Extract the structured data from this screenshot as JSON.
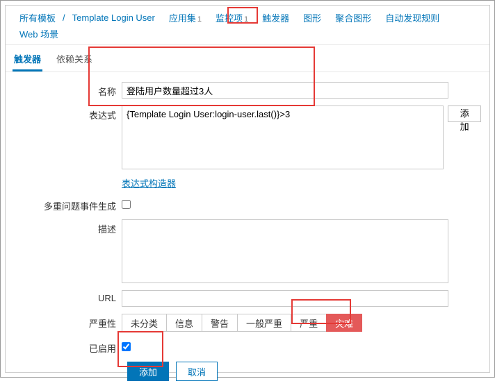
{
  "breadcrumb": {
    "root": "所有模板",
    "template": "Template Login User",
    "nav": [
      {
        "label": "应用集",
        "count": "1"
      },
      {
        "label": "监控项",
        "count": "1"
      },
      {
        "label": "触发器"
      },
      {
        "label": "图形"
      },
      {
        "label": "聚合图形"
      },
      {
        "label": "自动发现规则"
      },
      {
        "label": "Web 场景"
      }
    ]
  },
  "subtabs": {
    "trigger": "触发器",
    "deps": "依赖关系"
  },
  "form": {
    "name_label": "名称",
    "name_value": "登陆用户数量超过3人",
    "expression_label": "表达式",
    "expression_value": "{Template Login User:login-user.last()}>3",
    "add_expr": "添加",
    "expr_constructor": "表达式构造器",
    "multi_label": "多重问题事件生成",
    "multi_checked": false,
    "desc_label": "描述",
    "desc_value": "",
    "url_label": "URL",
    "url_value": "",
    "severity_label": "严重性",
    "severity": {
      "options": [
        "未分类",
        "信息",
        "警告",
        "一般严重",
        "严重",
        "灾难"
      ],
      "selected": "灾难"
    },
    "enabled_label": "已启用",
    "enabled_checked": true,
    "submit": "添加",
    "cancel": "取消"
  }
}
